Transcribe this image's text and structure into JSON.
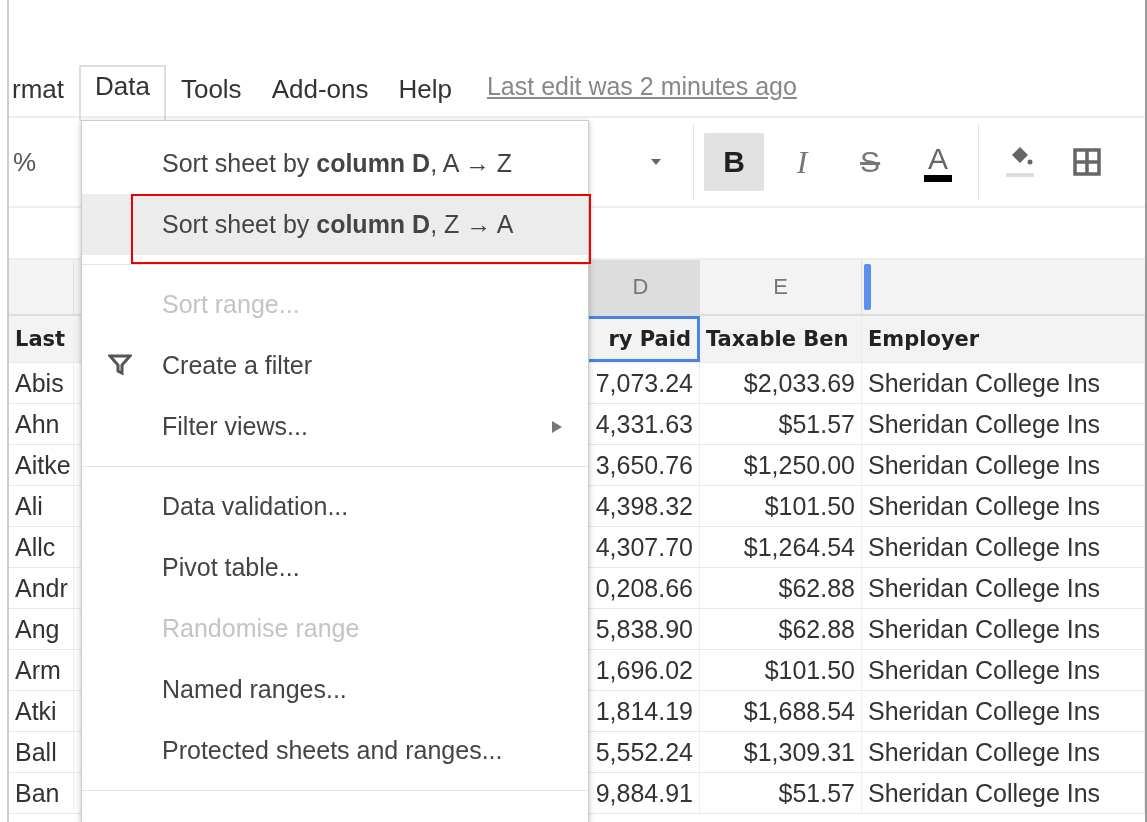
{
  "menubar": {
    "items": [
      {
        "label": "rmat",
        "selected": false
      },
      {
        "label": "Data",
        "selected": true
      },
      {
        "label": "Tools",
        "selected": false
      },
      {
        "label": "Add-ons",
        "selected": false
      },
      {
        "label": "Help",
        "selected": false
      }
    ],
    "last_edit": "Last edit was 2 minutes ago"
  },
  "toolbar": {
    "left_text": "%",
    "buttons": [
      {
        "kind": "bold",
        "label": "B",
        "selected": true
      },
      {
        "kind": "italic",
        "label": "I",
        "selected": false
      },
      {
        "kind": "strike",
        "label": "S",
        "selected": false
      },
      {
        "kind": "textcolor",
        "label": "A",
        "selected": false
      },
      {
        "kind": "fill",
        "selected": false
      },
      {
        "kind": "borders",
        "selected": false
      }
    ]
  },
  "columns": [
    {
      "label": "D",
      "selected": true
    },
    {
      "label": "E",
      "selected": false
    }
  ],
  "table": {
    "header": [
      "Last",
      "ry Paid",
      "Taxable Ben",
      "Employer"
    ],
    "rows": [
      [
        "Abis",
        "7,073.24",
        "$2,033.69",
        "Sheridan College Ins"
      ],
      [
        "Ahn",
        "4,331.63",
        "$51.57",
        "Sheridan College Ins"
      ],
      [
        "Aitke",
        "3,650.76",
        "$1,250.00",
        "Sheridan College Ins"
      ],
      [
        "Ali",
        "4,398.32",
        "$101.50",
        "Sheridan College Ins"
      ],
      [
        "Allc",
        "4,307.70",
        "$1,264.54",
        "Sheridan College Ins"
      ],
      [
        "Andr",
        "0,208.66",
        "$62.88",
        "Sheridan College Ins"
      ],
      [
        "Ang",
        "5,838.90",
        "$62.88",
        "Sheridan College Ins"
      ],
      [
        "Arm",
        "1,696.02",
        "$101.50",
        "Sheridan College Ins"
      ],
      [
        "Atki",
        "1,814.19",
        "$1,688.54",
        "Sheridan College Ins"
      ],
      [
        "Ball",
        "5,552.24",
        "$1,309.31",
        "Sheridan College Ins"
      ],
      [
        "Ban",
        "9,884.91",
        "$51.57",
        "Sheridan College Ins"
      ]
    ]
  },
  "menu": {
    "items": [
      {
        "kind": "item",
        "label": "Sort sheet by **column D**, A → Z",
        "disabled": false,
        "highlighted": false,
        "annotated": false
      },
      {
        "kind": "item",
        "label": "Sort sheet by **column D**, Z → A",
        "disabled": false,
        "highlighted": true,
        "annotated": true
      },
      {
        "kind": "separator"
      },
      {
        "kind": "item",
        "label": "Sort range...",
        "disabled": true,
        "highlighted": false,
        "annotated": false
      },
      {
        "kind": "filter",
        "label": "Create a filter",
        "disabled": false,
        "highlighted": false,
        "annotated": false
      },
      {
        "kind": "submenu",
        "label": "Filter views...",
        "disabled": false,
        "highlighted": false,
        "annotated": false
      },
      {
        "kind": "separator"
      },
      {
        "kind": "item",
        "label": "Data validation...",
        "disabled": false,
        "highlighted": false,
        "annotated": false
      },
      {
        "kind": "item",
        "label": "Pivot table...",
        "disabled": false,
        "highlighted": false,
        "annotated": false
      },
      {
        "kind": "item",
        "label": "Randomise range",
        "disabled": true,
        "highlighted": false,
        "annotated": false
      },
      {
        "kind": "item",
        "label": "Named ranges...",
        "disabled": false,
        "highlighted": false,
        "annotated": false
      },
      {
        "kind": "item",
        "label": "Protected sheets and ranges...",
        "disabled": false,
        "highlighted": false,
        "annotated": false
      },
      {
        "kind": "separator"
      }
    ]
  }
}
